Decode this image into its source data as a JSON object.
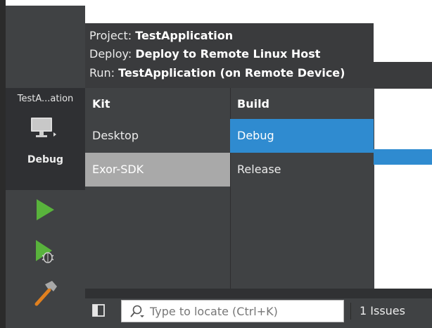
{
  "popup": {
    "project_label": "Project: ",
    "project_value": "TestApplication",
    "deploy_label": "Deploy: ",
    "deploy_value": "Deploy to Remote Linux Host",
    "run_label": "Run: ",
    "run_value": "TestApplication (on Remote Device)"
  },
  "kit_column": {
    "header": "Kit",
    "items": [
      {
        "label": "Desktop",
        "state": "normal"
      },
      {
        "label": "Exor-SDK",
        "state": "selected"
      }
    ]
  },
  "build_column": {
    "header": "Build",
    "items": [
      {
        "label": "Debug",
        "state": "selected"
      },
      {
        "label": "Release",
        "state": "normal"
      }
    ]
  },
  "sidebar": {
    "target_name": "TestA...ation",
    "build_mode": "Debug",
    "icons": {
      "target": "monitor-icon",
      "run": "run-icon",
      "debug": "debug-run-icon",
      "build": "hammer-icon"
    }
  },
  "bottom_bar": {
    "locator_placeholder": "Type to locate (Ctrl+K)",
    "issues_label": "1  Issues"
  },
  "colors": {
    "selection_blue": "#2f8bd0",
    "kit_selected": "#a9a9a9",
    "panel": "#404244",
    "run_green": "#59b33c"
  }
}
